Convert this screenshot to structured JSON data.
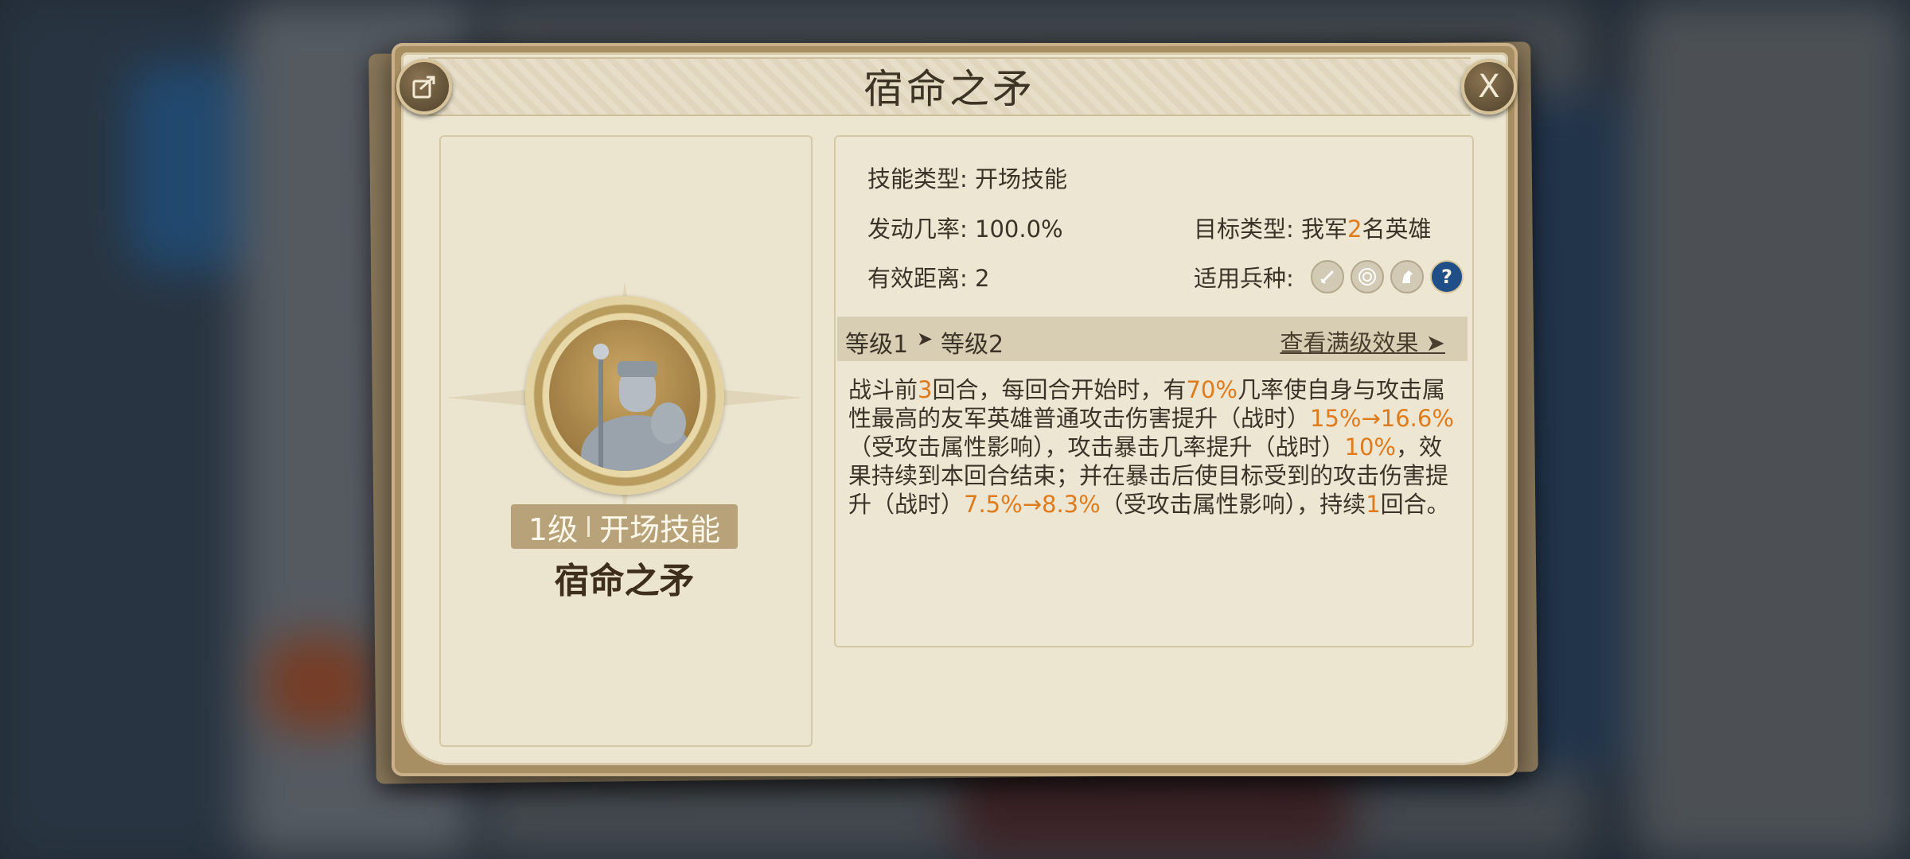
{
  "dialog": {
    "title": "宿命之矛",
    "share_icon": "share-icon",
    "close_label": "X"
  },
  "skill": {
    "level_label": "1级",
    "type_label": "开场技能",
    "name": "宿命之矛",
    "portrait_icon": "knight-portrait-icon"
  },
  "info": {
    "skill_type_label": "技能类型:",
    "skill_type_value": "开场技能",
    "trigger_rate_label": "发动几率:",
    "trigger_rate_value": "100.0%",
    "target_type_label": "目标类型:",
    "target_type_prefix": "我军",
    "target_type_count": "2",
    "target_type_suffix": "名英雄",
    "range_label": "有效距离:",
    "range_value": "2",
    "troop_types_label": "适用兵种:",
    "troop_icons": [
      "sword-icon",
      "target-icon",
      "horse-icon",
      "question-icon"
    ]
  },
  "levels": {
    "current": "等级1",
    "arrow": "➤",
    "next": "等级2",
    "view_full": "查看满级效果 ➤"
  },
  "description": {
    "segments": [
      {
        "text": "战斗前",
        "hl": false
      },
      {
        "text": "3",
        "hl": true
      },
      {
        "text": "回合，每回合开始时，有",
        "hl": false
      },
      {
        "text": "70%",
        "hl": true
      },
      {
        "text": "几率使自身与攻击属性最高的友军英雄普通攻击伤害提升（战时）",
        "hl": false
      },
      {
        "text": "15%→16.6%",
        "hl": true
      },
      {
        "text": "（受攻击属性影响），攻击暴击几率提升（战时）",
        "hl": false
      },
      {
        "text": "10%",
        "hl": true
      },
      {
        "text": "，效果持续到本回合结束；并在暴击后使目标受到的攻击伤害提升（战时）",
        "hl": false
      },
      {
        "text": "7.5%→8.3%",
        "hl": true
      },
      {
        "text": "（受攻击属性影响），持续",
        "hl": false
      },
      {
        "text": "1",
        "hl": true
      },
      {
        "text": "回合。",
        "hl": false
      }
    ]
  },
  "colors": {
    "highlight": "#e07b1c",
    "text": "#3b3327",
    "panel": "#ece5d0",
    "frame": "#a88f63"
  }
}
